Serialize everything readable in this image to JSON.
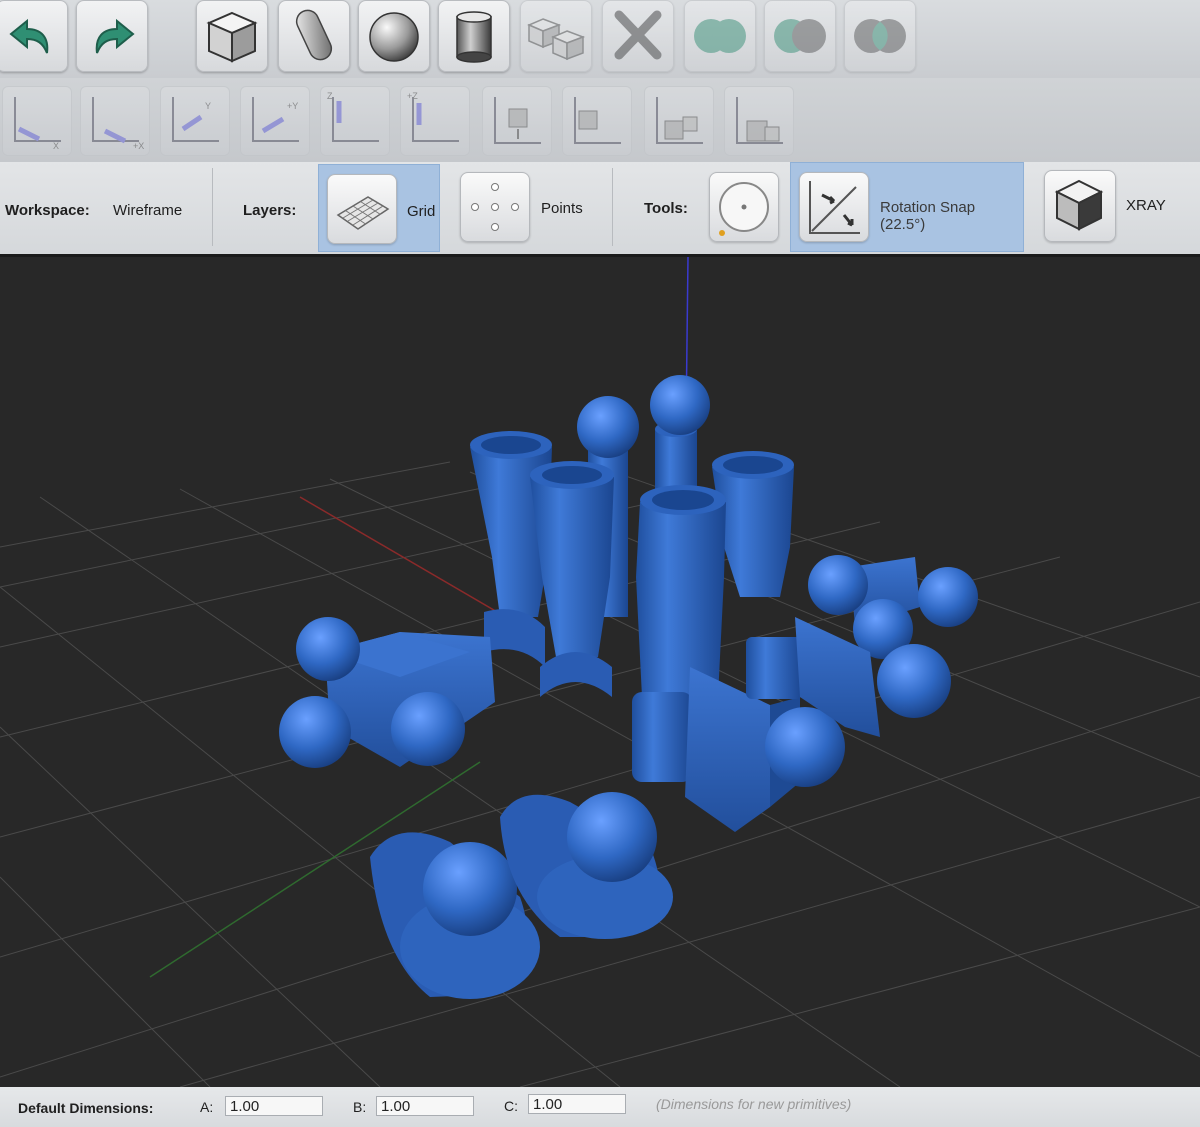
{
  "toolbar": {
    "buttons": [
      {
        "icon": "undo-icon"
      },
      {
        "icon": "redo-icon"
      },
      {
        "icon": "cube-primitive-icon"
      },
      {
        "icon": "capsule-primitive-icon"
      },
      {
        "icon": "sphere-primitive-icon"
      },
      {
        "icon": "cylinder-primitive-icon"
      },
      {
        "icon": "group-icon"
      },
      {
        "icon": "delete-icon"
      },
      {
        "icon": "union-icon"
      },
      {
        "icon": "subtract-icon"
      },
      {
        "icon": "intersect-icon"
      }
    ]
  },
  "view_toolbar": {
    "buttons": [
      {
        "icon": "move-x-icon"
      },
      {
        "icon": "move-x-positive-icon"
      },
      {
        "icon": "move-y-icon"
      },
      {
        "icon": "move-y-positive-icon"
      },
      {
        "icon": "move-z-down-icon"
      },
      {
        "icon": "move-z-up-icon"
      },
      {
        "icon": "snap-bottom-icon"
      },
      {
        "icon": "snap-side-icon"
      },
      {
        "icon": "snap-corner-icon"
      },
      {
        "icon": "snap-face-icon"
      }
    ]
  },
  "options": {
    "workspace_label": "Workspace:",
    "workspace_value": "Wireframe",
    "layers_label": "Layers:",
    "grid_label": "Grid",
    "points_label": "Points",
    "tools_label": "Tools:",
    "rotation_snap_label": "Rotation Snap (22.5°)",
    "xray_label": "XRAY"
  },
  "status": {
    "default_dimensions_label": "Default Dimensions:",
    "a_label": "A:",
    "a_value": "1.00",
    "b_label": "B:",
    "b_value": "1.00",
    "c_label": "C:",
    "c_value": "1.00",
    "hint": "(Dimensions for new primitives)"
  },
  "colors": {
    "model_blue": "#2f68c4",
    "highlight_blue": "#a9c3e2",
    "axis_red": "#8a2a2a",
    "axis_green": "#2f6a2f",
    "axis_blue": "#3a3ad0",
    "undo_green": "#2f8f73"
  }
}
